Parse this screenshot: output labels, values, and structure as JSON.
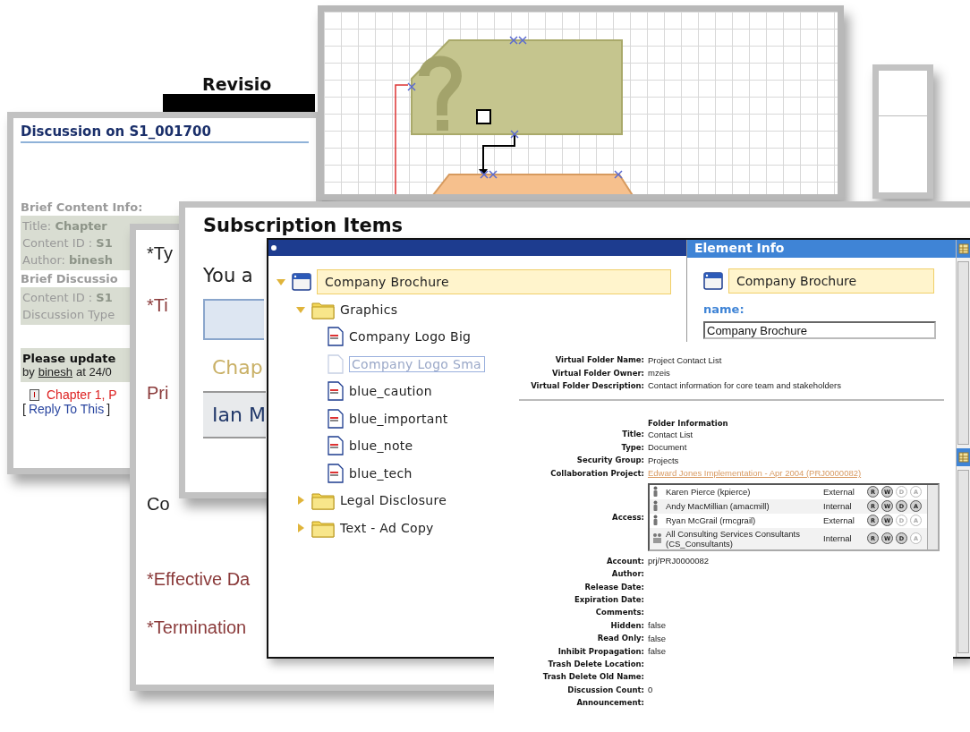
{
  "revision_window": {
    "heading": "Revisio"
  },
  "discussion_window": {
    "title": "Discussion on S1_001700",
    "content_heading": "Brief Content Info:",
    "content_info": [
      {
        "label": "Title:",
        "value": "Chapter"
      },
      {
        "label": "Content ID :",
        "value": "S1"
      },
      {
        "label": "Author:",
        "value": "binesh"
      }
    ],
    "discussion_heading": "Brief Discussio",
    "discussion_info": [
      {
        "label": "Content ID :",
        "value": "S1"
      },
      {
        "label": "Discussion Type"
      }
    ],
    "post": {
      "subject": "Please update",
      "by": "by",
      "author": "binesh",
      "time": "at 24/0"
    },
    "reply": {
      "title": "Chapter 1, P",
      "open": "[",
      "link": "Reply To This",
      "close": "]"
    }
  },
  "form_window": {
    "fields": [
      {
        "label": "*Ty",
        "color": "#222222"
      },
      {
        "label": "*Ti",
        "color": "#8a3a3a"
      },
      {
        "label": "Pri",
        "color": "#8a3a3a"
      },
      {
        "label": "Co",
        "color": "#222222"
      },
      {
        "label": "*Effective Da",
        "color": "#8a3a3a"
      },
      {
        "label": "*Termination",
        "color": "#8a3a3a"
      }
    ]
  },
  "subscription_window": {
    "title": "Subscription Items",
    "intro": "You a",
    "rows": [
      {
        "text": "Chap",
        "kind": "content"
      },
      {
        "text": "Ian M",
        "kind": "person"
      }
    ]
  },
  "tree_window": {
    "tree": [
      {
        "label": "Company Brochure",
        "kind": "element",
        "expanded": true,
        "selected": true,
        "children": [
          {
            "label": "Graphics",
            "kind": "folder",
            "expanded": true,
            "selected": false,
            "children": [
              {
                "label": "Company Logo Big",
                "kind": "file",
                "selected": false,
                "editing": false
              },
              {
                "label": "Company Logo Sma",
                "kind": "file",
                "selected": false,
                "editing": true
              },
              {
                "label": "blue_caution",
                "kind": "file",
                "selected": false,
                "editing": false
              },
              {
                "label": "blue_important",
                "kind": "file",
                "selected": false,
                "editing": false
              },
              {
                "label": "blue_note",
                "kind": "file",
                "selected": false,
                "editing": false
              },
              {
                "label": "blue_tech",
                "kind": "file",
                "selected": false,
                "editing": false
              }
            ]
          },
          {
            "label": "Legal Disclosure",
            "kind": "folder",
            "expanded": false,
            "selected": false
          },
          {
            "label": "Text - Ad Copy",
            "kind": "folder",
            "expanded": false,
            "selected": false
          }
        ]
      }
    ],
    "element_info": {
      "title": "Element Info",
      "element": "Company Brochure",
      "field_label": "name:",
      "field_value": "Company Brochure"
    }
  },
  "folder_info": {
    "virtual_fields": [
      {
        "label": "Virtual Folder Name:",
        "value": "Project Contact List"
      },
      {
        "label": "Virtual Folder Owner:",
        "value": "mzeis"
      },
      {
        "label": "Virtual Folder Description:",
        "value": "Contact information for core team and stakeholders"
      }
    ],
    "section_title": "Folder Information",
    "fields": [
      {
        "label": "Title:",
        "value": "Contact List",
        "kind": "text"
      },
      {
        "label": "Type:",
        "value": "Document",
        "kind": "text"
      },
      {
        "label": "Security Group:",
        "value": "Projects",
        "kind": "text"
      },
      {
        "label": "Collaboration Project:",
        "value": "Edward Jones Implementation - Apr 2004 (PRJ0000082)",
        "kind": "link"
      }
    ],
    "access_label": "Access:",
    "access": [
      {
        "name": "Karen Pierce (kpierce)",
        "kind": "user",
        "scope": "External",
        "permissions": [
          {
            "letter": "R",
            "granted": true
          },
          {
            "letter": "W",
            "granted": true
          },
          {
            "letter": "D",
            "granted": false
          },
          {
            "letter": "A",
            "granted": false
          }
        ]
      },
      {
        "name": "Andy MacMillian (amacmill)",
        "kind": "user",
        "scope": "Internal",
        "permissions": [
          {
            "letter": "R",
            "granted": true
          },
          {
            "letter": "W",
            "granted": true
          },
          {
            "letter": "D",
            "granted": true
          },
          {
            "letter": "A",
            "granted": true
          }
        ]
      },
      {
        "name": "Ryan McGrail (rmcgrail)",
        "kind": "user",
        "scope": "External",
        "permissions": [
          {
            "letter": "R",
            "granted": true
          },
          {
            "letter": "W",
            "granted": true
          },
          {
            "letter": "D",
            "granted": false
          },
          {
            "letter": "A",
            "granted": false
          }
        ]
      },
      {
        "name": "All Consulting Services Consultants (CS_Consultants)",
        "kind": "group",
        "scope": "Internal",
        "permissions": [
          {
            "letter": "R",
            "granted": true
          },
          {
            "letter": "W",
            "granted": true
          },
          {
            "letter": "D",
            "granted": true
          },
          {
            "letter": "A",
            "granted": false
          }
        ]
      }
    ],
    "more_fields": [
      {
        "label": "Account:",
        "value": "prj/PRJ0000082"
      },
      {
        "label": "Author:"
      },
      {
        "label": "Release Date:"
      },
      {
        "label": "Expiration Date:"
      },
      {
        "label": "Comments:"
      },
      {
        "label": "Hidden:",
        "value": "false"
      },
      {
        "label": "Read Only:",
        "value": "false"
      },
      {
        "label": "Inhibit Propagation:",
        "value": "false"
      },
      {
        "label": "Trash Delete Location:"
      },
      {
        "label": "Trash Delete Old Name:"
      },
      {
        "label": "Discussion Count:",
        "value": "0"
      },
      {
        "label": "Announcement:"
      }
    ]
  }
}
